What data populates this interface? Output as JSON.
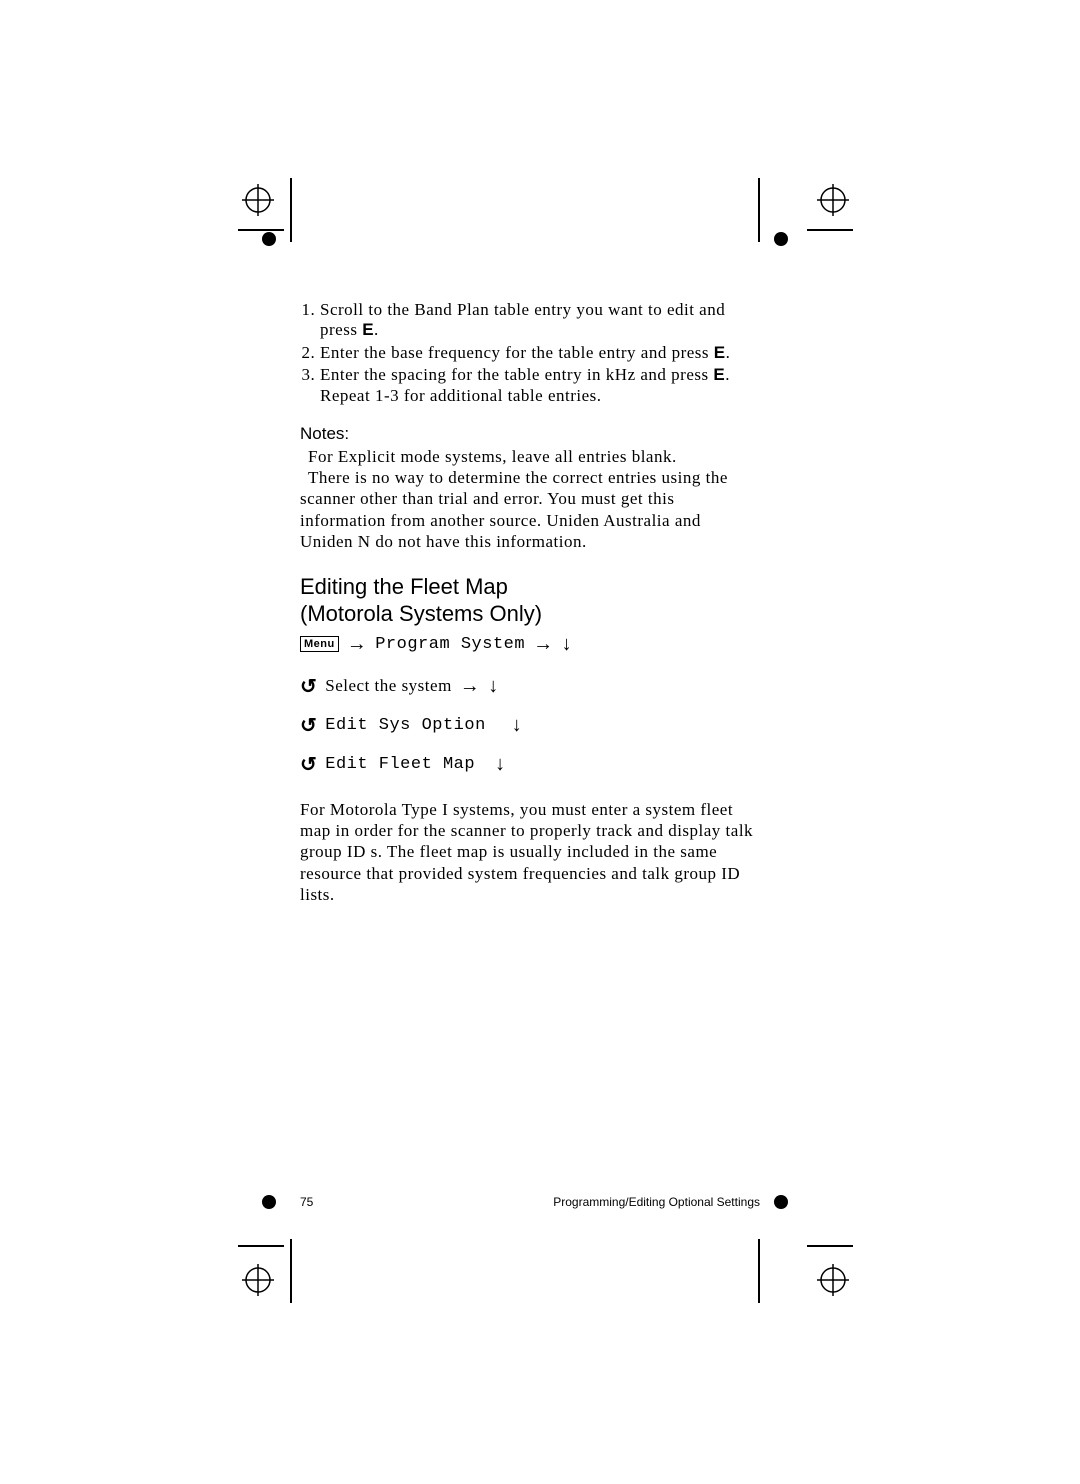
{
  "steps": [
    {
      "pre": "Scroll to the Band Plan table entry you want to edit and press ",
      "key": "E",
      "post": "."
    },
    {
      "pre": "Enter the base frequency for the table entry and press ",
      "key": "E",
      "post": "."
    },
    {
      "pre": "Enter the spacing for the table entry in kHz and press ",
      "key": "E",
      "post": ".",
      "extra": "Repeat 1-3 for additional table entries."
    }
  ],
  "notes": {
    "heading": "Notes:",
    "lines": [
      "For Explicit mode systems, leave all entries blank.",
      "There is no way to determine the correct entries using the scanner other than trial and error. You must get this information from another source. Uniden Australia and Uniden N do not have this information."
    ]
  },
  "section_title_line1": "Editing the Fleet Map",
  "section_title_line2": "(Motorola Systems Only)",
  "nav": {
    "menu_label": "Menu",
    "program_system": "Program System",
    "select_system": "Select the system",
    "edit_sys_option": "Edit Sys Option",
    "edit_fleet_map": "Edit Fleet Map"
  },
  "icons": {
    "arrow_right": "→",
    "arrow_down": "↓",
    "rotate": "↺"
  },
  "paragraph": "For Motorola Type I systems, you must enter a system fleet map in order for the scanner to properly track and display talk group ID s. The fleet map is usually included in the same resource that provided system frequencies and talk group ID lists.",
  "footer": {
    "page_number": "75",
    "section": "Programming/Editing Optional Settings"
  }
}
